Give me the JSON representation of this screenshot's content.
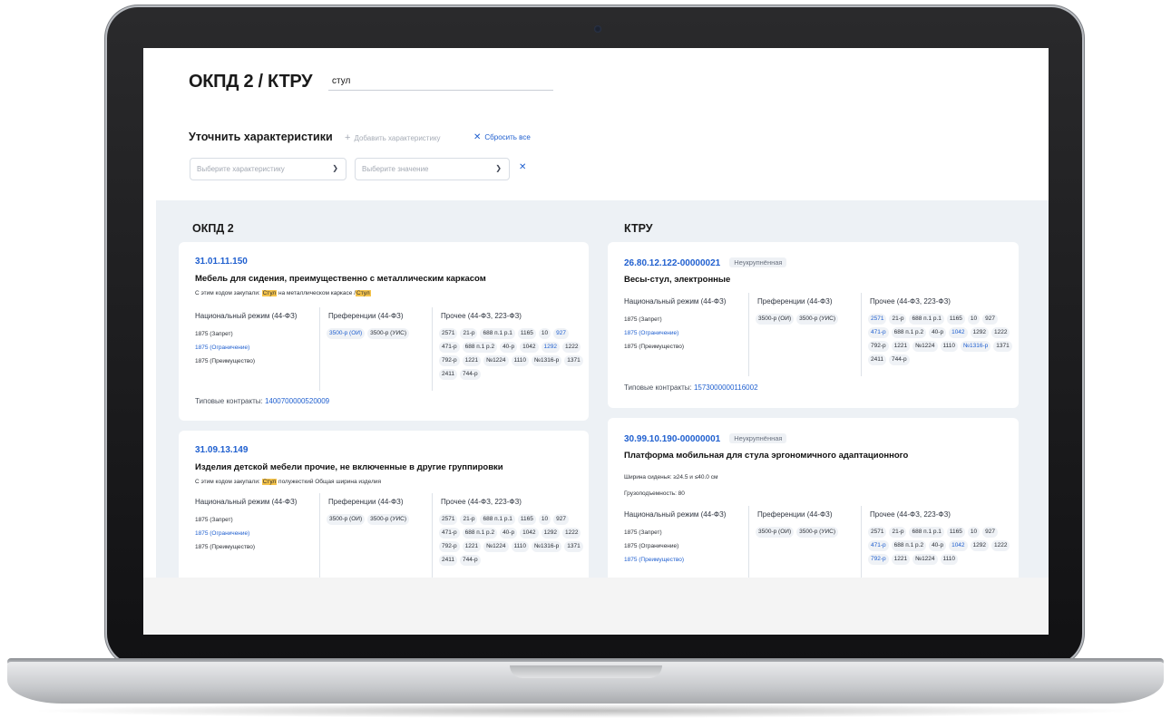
{
  "header": {
    "title": "ОКПД 2 / КТРУ",
    "search_value": "стул"
  },
  "refine": {
    "title": "Уточнить характеристики",
    "add_label": "Добавить характеристику",
    "reset_label": "Сбросить все",
    "select_characteristic_placeholder": "Выберите характеристику",
    "select_value_placeholder": "Выберите значение"
  },
  "columns": {
    "okpd_title": "ОКПД 2",
    "ktru_title": "КТРУ"
  },
  "labels": {
    "national": "Национальный режим (44-ФЗ)",
    "preferences": "Преференции (44-ФЗ)",
    "other": "Прочее (44-ФЗ, 223-ФЗ)",
    "typical_prefix": "Типовые контракты:"
  },
  "okpd": [
    {
      "code": "31.01.11.150",
      "name": "Мебель для сидения, преимущественно с металлическим каркасом",
      "meta_prefix": "С этим кодом закупали:",
      "meta_hl1": "Стул",
      "meta_mid": "на металлическом каркасе /",
      "meta_hl2": "Стул",
      "national": [
        {
          "text": "1875 (Запрет)",
          "blue": false
        },
        {
          "text": "1875 (Ограничение)",
          "blue": true
        },
        {
          "text": "1875 (Преимущество)",
          "blue": false
        }
      ],
      "preferences": [
        {
          "text": "3500-р (ОИ)",
          "blue": true
        },
        {
          "text": "3500-р (УИС)",
          "blue": false
        }
      ],
      "other": [
        {
          "text": "2571",
          "blue": false
        },
        {
          "text": "21-р",
          "blue": false
        },
        {
          "text": "688 п.1 р.1",
          "blue": false
        },
        {
          "text": "1165",
          "blue": false
        },
        {
          "text": "10",
          "blue": false
        },
        {
          "text": "927",
          "blue": true
        },
        {
          "text": "471-р",
          "blue": false
        },
        {
          "text": "688 п.1 р.2",
          "blue": false
        },
        {
          "text": "40-р",
          "blue": false
        },
        {
          "text": "1042",
          "blue": false
        },
        {
          "text": "1292",
          "blue": true
        },
        {
          "text": "1222",
          "blue": false
        },
        {
          "text": "792-р",
          "blue": false
        },
        {
          "text": "1221",
          "blue": false
        },
        {
          "text": "№1224",
          "blue": false
        },
        {
          "text": "1110",
          "blue": false
        },
        {
          "text": "№1316-р",
          "blue": false
        },
        {
          "text": "1371",
          "blue": false
        },
        {
          "text": "2411",
          "blue": false
        },
        {
          "text": "744-р",
          "blue": false
        }
      ],
      "typical_value": "1400700000520009"
    },
    {
      "code": "31.09.13.149",
      "name": "Изделия детской мебели прочие, не включенные в другие группировки",
      "meta_prefix": "С этим кодом закупали:",
      "meta_hl1": "Стул",
      "meta_mid": "полужесткий Общая ширина изделия",
      "national": [
        {
          "text": "1875 (Запрет)",
          "blue": false
        },
        {
          "text": "1875 (Ограничение)",
          "blue": true
        },
        {
          "text": "1875 (Преимущество)",
          "blue": false
        }
      ],
      "preferences": [
        {
          "text": "3500-р (ОИ)",
          "blue": false
        },
        {
          "text": "3500-р (УИС)",
          "blue": false
        }
      ],
      "other": [
        {
          "text": "2571",
          "blue": false
        },
        {
          "text": "21-р",
          "blue": false
        },
        {
          "text": "688 п.1 р.1",
          "blue": false
        },
        {
          "text": "1165",
          "blue": false
        },
        {
          "text": "10",
          "blue": false
        },
        {
          "text": "927",
          "blue": false
        },
        {
          "text": "471-р",
          "blue": false
        },
        {
          "text": "688 п.1 р.2",
          "blue": false
        },
        {
          "text": "40-р",
          "blue": false
        },
        {
          "text": "1042",
          "blue": false
        },
        {
          "text": "1292",
          "blue": false
        },
        {
          "text": "1222",
          "blue": false
        },
        {
          "text": "792-р",
          "blue": false
        },
        {
          "text": "1221",
          "blue": false
        },
        {
          "text": "№1224",
          "blue": false
        },
        {
          "text": "1110",
          "blue": false
        },
        {
          "text": "№1316-р",
          "blue": false
        },
        {
          "text": "1371",
          "blue": false
        },
        {
          "text": "2411",
          "blue": false
        },
        {
          "text": "744-р",
          "blue": false
        }
      ]
    }
  ],
  "ktru": [
    {
      "code": "26.80.12.122-00000021",
      "status": "Неукрупнённая",
      "name": "Весы-стул, электронные",
      "national": [
        {
          "text": "1875 (Запрет)",
          "blue": false
        },
        {
          "text": "1875 (Ограничение)",
          "blue": true
        },
        {
          "text": "1875 (Преимущество)",
          "blue": false
        }
      ],
      "preferences": [
        {
          "text": "3500-р (ОИ)",
          "blue": false
        },
        {
          "text": "3500-р (УИС)",
          "blue": false
        }
      ],
      "other": [
        {
          "text": "2571",
          "blue": true
        },
        {
          "text": "21-р",
          "blue": false
        },
        {
          "text": "688 п.1 р.1",
          "blue": false
        },
        {
          "text": "1165",
          "blue": false
        },
        {
          "text": "10",
          "blue": false
        },
        {
          "text": "927",
          "blue": false
        },
        {
          "text": "471-р",
          "blue": true
        },
        {
          "text": "688 п.1 р.2",
          "blue": false
        },
        {
          "text": "40-р",
          "blue": false
        },
        {
          "text": "1042",
          "blue": true
        },
        {
          "text": "1292",
          "blue": false
        },
        {
          "text": "1222",
          "blue": false
        },
        {
          "text": "792-р",
          "blue": false
        },
        {
          "text": "1221",
          "blue": false
        },
        {
          "text": "№1224",
          "blue": false
        },
        {
          "text": "1110",
          "blue": false
        },
        {
          "text": "№1316-р",
          "blue": true
        },
        {
          "text": "1371",
          "blue": false
        },
        {
          "text": "2411",
          "blue": false
        },
        {
          "text": "744-р",
          "blue": false
        }
      ],
      "typical_value": "1573000000116002"
    },
    {
      "code": "30.99.10.190-00000001",
      "status": "Неукрупнённая",
      "name": "Платформа мобильная для стула эргономичного адаптационного",
      "width_line": "Ширина сиденья: ≥24.5 и ≤40.0 см",
      "load_line": "Грузоподъемность: 80",
      "national": [
        {
          "text": "1875 (Запрет)",
          "blue": false
        },
        {
          "text": "1875 (Ограничение)",
          "blue": false
        },
        {
          "text": "1875 (Преимущество)",
          "blue": true
        }
      ],
      "preferences": [
        {
          "text": "3500-р (ОИ)",
          "blue": false
        },
        {
          "text": "3500-р (УИС)",
          "blue": false
        }
      ],
      "other": [
        {
          "text": "2571",
          "blue": false
        },
        {
          "text": "21-р",
          "blue": false
        },
        {
          "text": "688 п.1 р.1",
          "blue": false
        },
        {
          "text": "1165",
          "blue": false
        },
        {
          "text": "10",
          "blue": false
        },
        {
          "text": "927",
          "blue": false
        },
        {
          "text": "471-р",
          "blue": true
        },
        {
          "text": "688 п.1 р.2",
          "blue": false
        },
        {
          "text": "40-р",
          "blue": false
        },
        {
          "text": "1042",
          "blue": true
        },
        {
          "text": "1292",
          "blue": false
        },
        {
          "text": "1222",
          "blue": false
        },
        {
          "text": "792-р",
          "blue": true
        },
        {
          "text": "1221",
          "blue": false
        },
        {
          "text": "№1224",
          "blue": false
        },
        {
          "text": "1110",
          "blue": false
        }
      ]
    }
  ],
  "icons": {
    "plus": "plus-icon",
    "close": "close-icon",
    "chevron": "chevron-down-icon"
  }
}
